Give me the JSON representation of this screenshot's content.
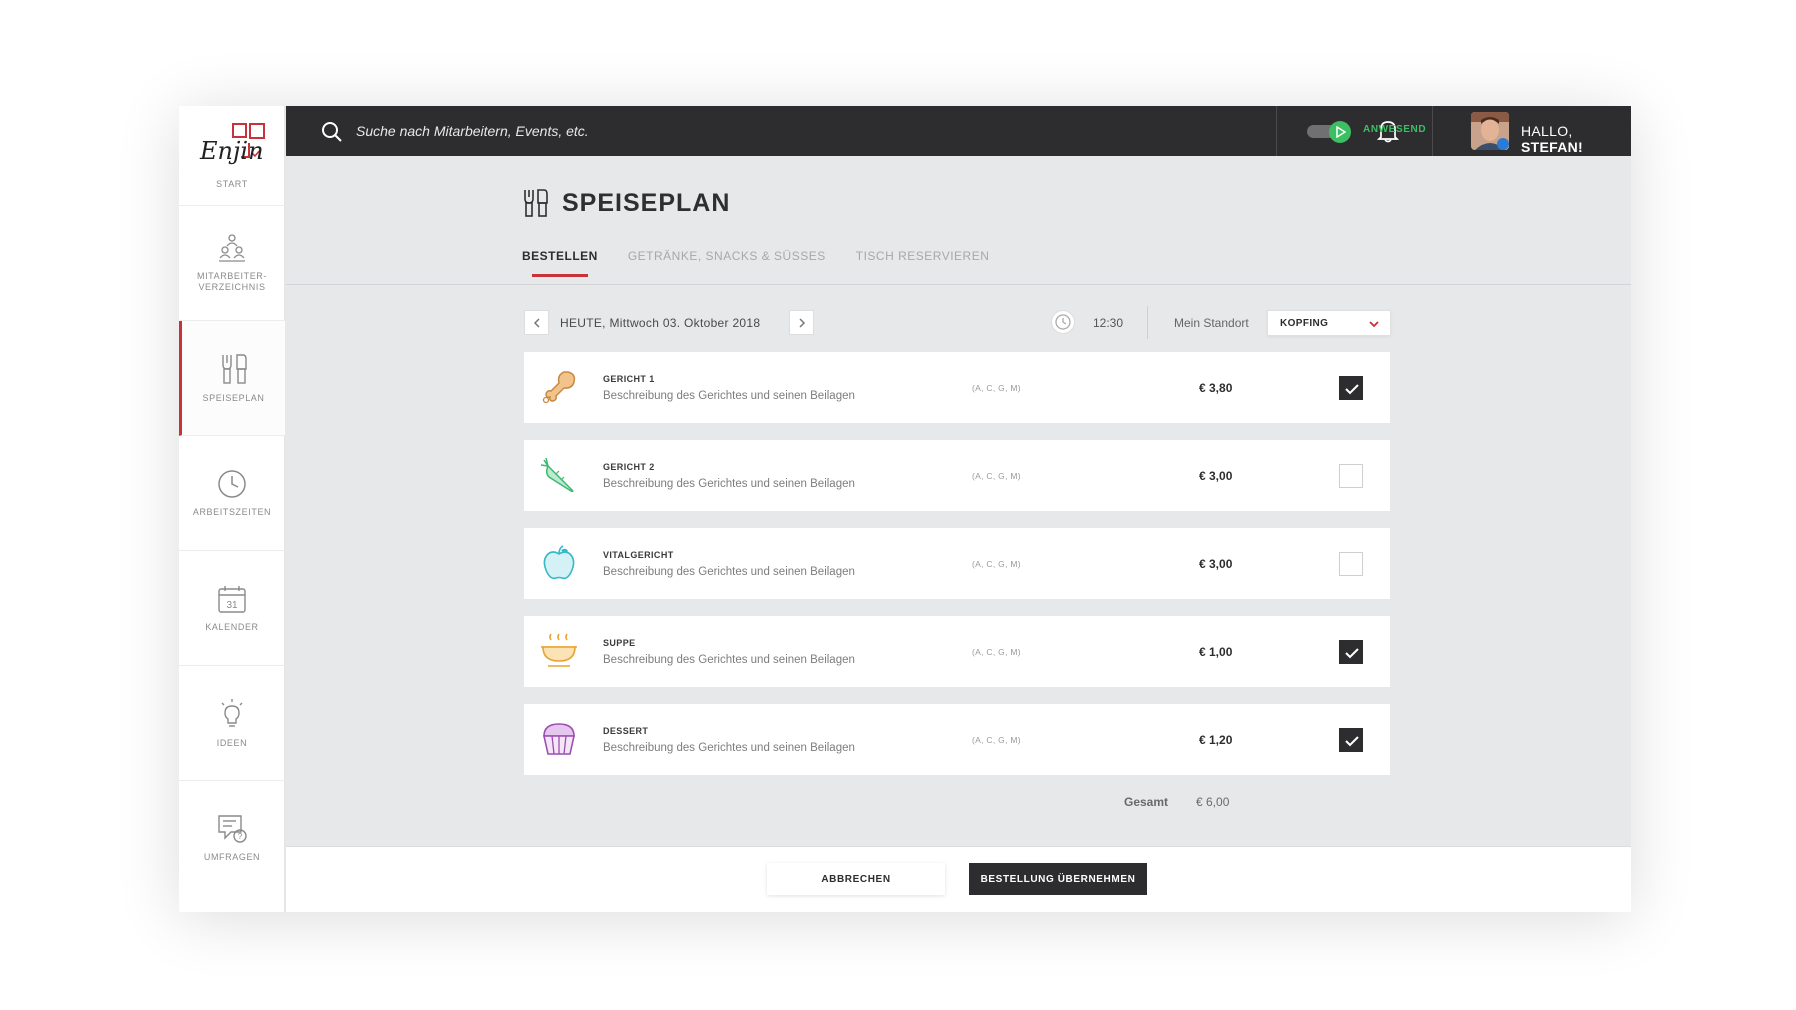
{
  "sidebar": {
    "logo_text": "Enjin",
    "items": [
      {
        "label": "START",
        "icon": "enjin-logo"
      },
      {
        "label": "MITARBEITER-\nVERZEICHNIS",
        "icon": "people-icon"
      },
      {
        "label": "SPEISEPLAN",
        "icon": "cutlery-icon",
        "active": true
      },
      {
        "label": "ARBEITSZEITEN",
        "icon": "clock-icon"
      },
      {
        "label": "KALENDER",
        "icon": "calendar-icon",
        "calendar_day": "31"
      },
      {
        "label": "IDEEN",
        "icon": "lightbulb-icon"
      },
      {
        "label": "UMFRAGEN",
        "icon": "survey-icon"
      }
    ]
  },
  "topbar": {
    "search_placeholder": "Suche nach Mitarbeitern, Events, etc.",
    "status_label": "ANWESEND",
    "greeting_prefix": "HALLO,",
    "greeting_name": "STEFAN!",
    "status_color": "#3cbf63"
  },
  "page": {
    "title": "SPEISEPLAN",
    "tabs": [
      {
        "label": "BESTELLEN",
        "active": true
      },
      {
        "label": "GETRÄNKE, SNACKS & SÜSSES",
        "active": false
      },
      {
        "label": "TISCH RESERVIEREN",
        "active": false
      }
    ],
    "date_text": "HEUTE, Mittwoch 03. Oktober 2018",
    "time": "12:30",
    "location_label": "Mein Standort",
    "location_value": "KOPFING",
    "accent_color": "#c8323c"
  },
  "menu": [
    {
      "name": "GERICHT 1",
      "description": "Beschreibung des Gerichtes und seinen Beilagen",
      "allergens": "(A, C, G, M)",
      "price": "€ 3,80",
      "checked": true,
      "icon": "chicken-leg-icon"
    },
    {
      "name": "GERICHT 2",
      "description": "Beschreibung des Gerichtes und seinen Beilagen",
      "allergens": "(A, C, G, M)",
      "price": "€ 3,00",
      "checked": false,
      "icon": "carrot-icon"
    },
    {
      "name": "VITALGERICHT",
      "description": "Beschreibung des Gerichtes und seinen Beilagen",
      "allergens": "(A, C, G, M)",
      "price": "€ 3,00",
      "checked": false,
      "icon": "apple-icon"
    },
    {
      "name": "SUPPE",
      "description": "Beschreibung des Gerichtes und seinen Beilagen",
      "allergens": "(A, C, G, M)",
      "price": "€ 1,00",
      "checked": true,
      "icon": "soup-icon"
    },
    {
      "name": "DESSERT",
      "description": "Beschreibung des Gerichtes und seinen Beilagen",
      "allergens": "(A, C, G, M)",
      "price": "€ 1,20",
      "checked": true,
      "icon": "cupcake-icon"
    }
  ],
  "total": {
    "label": "Gesamt",
    "value": "€ 6,00"
  },
  "footer": {
    "cancel_label": "ABBRECHEN",
    "submit_label": "BESTELLUNG ÜBERNEHMEN"
  }
}
